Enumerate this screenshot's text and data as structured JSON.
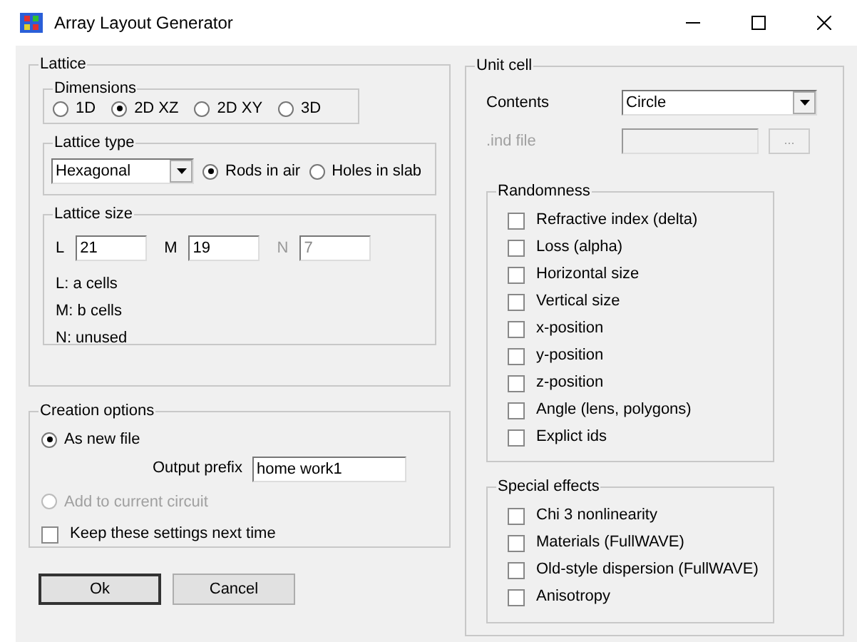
{
  "window": {
    "title": "Array Layout Generator"
  },
  "lattice": {
    "title": "Lattice",
    "dimensions": {
      "title": "Dimensions",
      "options": [
        {
          "label": "1D",
          "selected": false
        },
        {
          "label": "2D XZ",
          "selected": true
        },
        {
          "label": "2D XY",
          "selected": false
        },
        {
          "label": "3D",
          "selected": false
        }
      ]
    },
    "lattice_type": {
      "title": "Lattice type",
      "value": "Hexagonal",
      "options": [
        {
          "label": "Rods in air",
          "selected": true
        },
        {
          "label": "Holes in slab",
          "selected": false
        }
      ]
    },
    "lattice_size": {
      "title": "Lattice size",
      "fields": [
        {
          "label": "L",
          "value": "21",
          "disabled": false
        },
        {
          "label": "M",
          "value": "19",
          "disabled": false
        },
        {
          "label": "N",
          "value": "7",
          "disabled": true
        }
      ],
      "notes": [
        "L: a cells",
        "M: b cells",
        "N: unused"
      ]
    }
  },
  "creation_options": {
    "title": "Creation options",
    "options": [
      {
        "label": "As new file",
        "selected": true,
        "disabled": false
      },
      {
        "label": "Add to current circuit",
        "selected": false,
        "disabled": true
      }
    ],
    "output_prefix": {
      "label": "Output prefix",
      "value": "home work1"
    },
    "keep_settings": {
      "label": "Keep these settings next time",
      "checked": false
    }
  },
  "buttons": [
    "Ok",
    "Cancel"
  ],
  "unit_cell": {
    "title": "Unit cell",
    "contents": {
      "label": "Contents",
      "value": "Circle"
    },
    "ind_file": {
      "label": ".ind file",
      "button": "...",
      "disabled": true
    },
    "randomness": {
      "title": "Randomness",
      "items": [
        {
          "label": "Refractive index (delta)",
          "checked": false
        },
        {
          "label": "Loss (alpha)",
          "checked": false
        },
        {
          "label": "Horizontal size",
          "checked": false
        },
        {
          "label": "Vertical size",
          "checked": false
        },
        {
          "label": "x-position",
          "checked": false
        },
        {
          "label": "y-position",
          "checked": false
        },
        {
          "label": "z-position",
          "checked": false
        },
        {
          "label": "Angle (lens, polygons)",
          "checked": false
        },
        {
          "label": "Explict ids",
          "checked": false
        }
      ]
    },
    "special_effects": {
      "title": "Special effects",
      "items": [
        {
          "label": "Chi 3 nonlinearity",
          "checked": false
        },
        {
          "label": "Materials (FullWAVE)",
          "checked": false
        },
        {
          "label": "Old-style dispersion (FullWAVE)",
          "checked": false
        },
        {
          "label": "Anisotropy",
          "checked": false
        }
      ]
    }
  }
}
